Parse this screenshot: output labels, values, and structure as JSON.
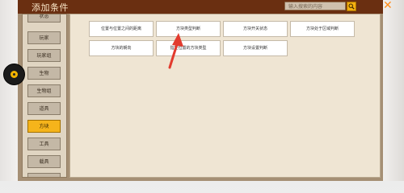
{
  "window": {
    "title": "添加条件",
    "search_placeholder": "输入搜索的内容",
    "close_symbol": "✕"
  },
  "sidebar": {
    "items": [
      {
        "label": "状态"
      },
      {
        "label": "玩家"
      },
      {
        "label": "玩家组"
      },
      {
        "label": "生物"
      },
      {
        "label": "生物组"
      },
      {
        "label": "道具"
      },
      {
        "label": "方块"
      },
      {
        "label": "工具"
      },
      {
        "label": "载具"
      }
    ],
    "active_index": 6
  },
  "options": [
    {
      "label": "位置与位置之间的距离"
    },
    {
      "label": "方块类型判断"
    },
    {
      "label": "方块开关状态"
    },
    {
      "label": "方块处于区域判断"
    },
    {
      "label": "方块的朝向"
    },
    {
      "label": "指定位置的方块类型"
    },
    {
      "label": "方块设置判断"
    }
  ],
  "colors": {
    "titlebar": "#6a2f11",
    "accent": "#f5b41b",
    "close": "#ff8c1a",
    "annotation_arrow": "#e23b2e"
  }
}
